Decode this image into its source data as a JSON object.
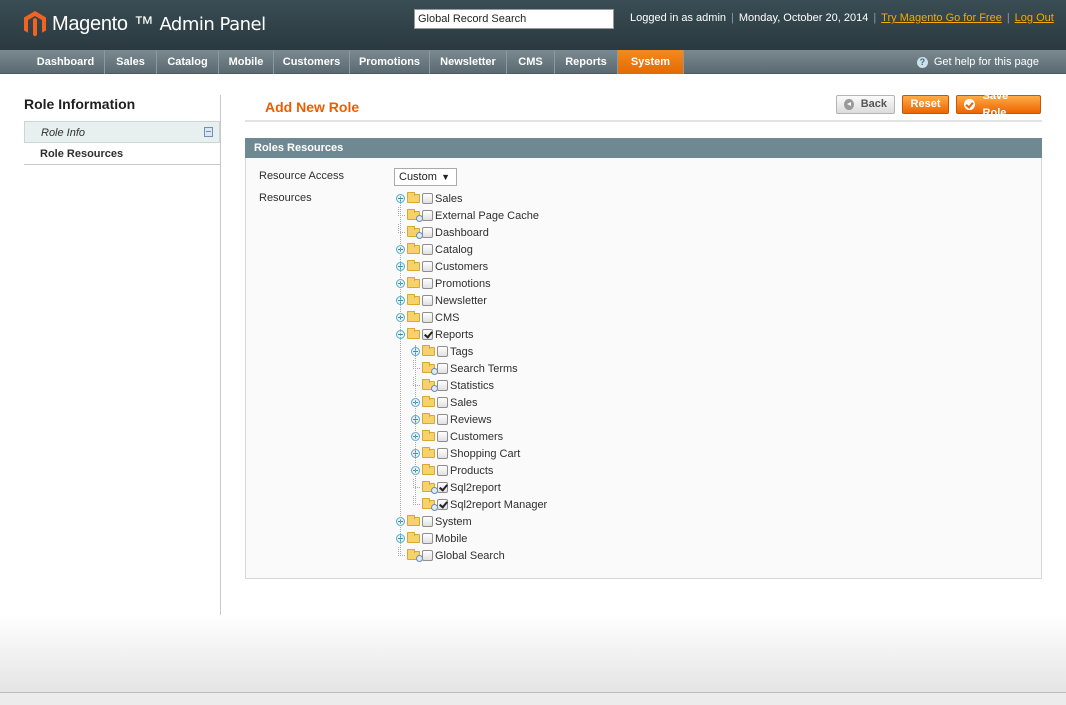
{
  "header": {
    "logo_text": "Magento",
    "logo_sub": "Admin Panel",
    "search_value": "Global Record Search",
    "logged_in": "Logged in as admin",
    "date": "Monday, October 20, 2014",
    "try_link": "Try Magento Go for Free",
    "logout_link": "Log Out"
  },
  "nav": {
    "items": [
      "Dashboard",
      "Sales",
      "Catalog",
      "Mobile",
      "Customers",
      "Promotions",
      "Newsletter",
      "CMS",
      "Reports",
      "System"
    ],
    "active": "System",
    "help": "Get help for this page"
  },
  "sidebar": {
    "title": "Role Information",
    "tabs": [
      "Role Info",
      "Role Resources"
    ]
  },
  "page": {
    "title": "Add New Role",
    "buttons": {
      "back": "Back",
      "reset": "Reset",
      "save": "Save Role"
    }
  },
  "fieldset": {
    "title": "Roles Resources",
    "resource_access_label": "Resource Access",
    "resource_access_value": "Custom",
    "resources_label": "Resources"
  },
  "tree": [
    {
      "label": "Sales",
      "level": 0,
      "toggle": "plus",
      "checked": false
    },
    {
      "label": "External Page Cache",
      "level": 0,
      "toggle": "leaf",
      "checked": false
    },
    {
      "label": "Dashboard",
      "level": 0,
      "toggle": "leaf",
      "checked": false
    },
    {
      "label": "Catalog",
      "level": 0,
      "toggle": "plus",
      "checked": false
    },
    {
      "label": "Customers",
      "level": 0,
      "toggle": "plus",
      "checked": false
    },
    {
      "label": "Promotions",
      "level": 0,
      "toggle": "plus",
      "checked": false
    },
    {
      "label": "Newsletter",
      "level": 0,
      "toggle": "plus",
      "checked": false
    },
    {
      "label": "CMS",
      "level": 0,
      "toggle": "plus",
      "checked": false
    },
    {
      "label": "Reports",
      "level": 0,
      "toggle": "minus",
      "checked": true
    },
    {
      "label": "Tags",
      "level": 1,
      "toggle": "plus",
      "checked": false
    },
    {
      "label": "Search Terms",
      "level": 1,
      "toggle": "leaf",
      "checked": false
    },
    {
      "label": "Statistics",
      "level": 1,
      "toggle": "leaf",
      "checked": false
    },
    {
      "label": "Sales",
      "level": 1,
      "toggle": "plus",
      "checked": false
    },
    {
      "label": "Reviews",
      "level": 1,
      "toggle": "plus",
      "checked": false
    },
    {
      "label": "Customers",
      "level": 1,
      "toggle": "plus",
      "checked": false
    },
    {
      "label": "Shopping Cart",
      "level": 1,
      "toggle": "plus",
      "checked": false
    },
    {
      "label": "Products",
      "level": 1,
      "toggle": "plus",
      "checked": false
    },
    {
      "label": "Sql2report",
      "level": 1,
      "toggle": "leaf",
      "checked": true
    },
    {
      "label": "Sql2report Manager",
      "level": 1,
      "toggle": "leaf",
      "checked": true
    },
    {
      "label": "System",
      "level": 0,
      "toggle": "plus",
      "checked": false
    },
    {
      "label": "Mobile",
      "level": 0,
      "toggle": "plus",
      "checked": false
    },
    {
      "label": "Global Search",
      "level": 0,
      "toggle": "leaf",
      "checked": false
    }
  ],
  "colors": {
    "accent": "#eb5e00",
    "header_bg": "#2f4148",
    "fieldset_head": "#6f8992"
  }
}
